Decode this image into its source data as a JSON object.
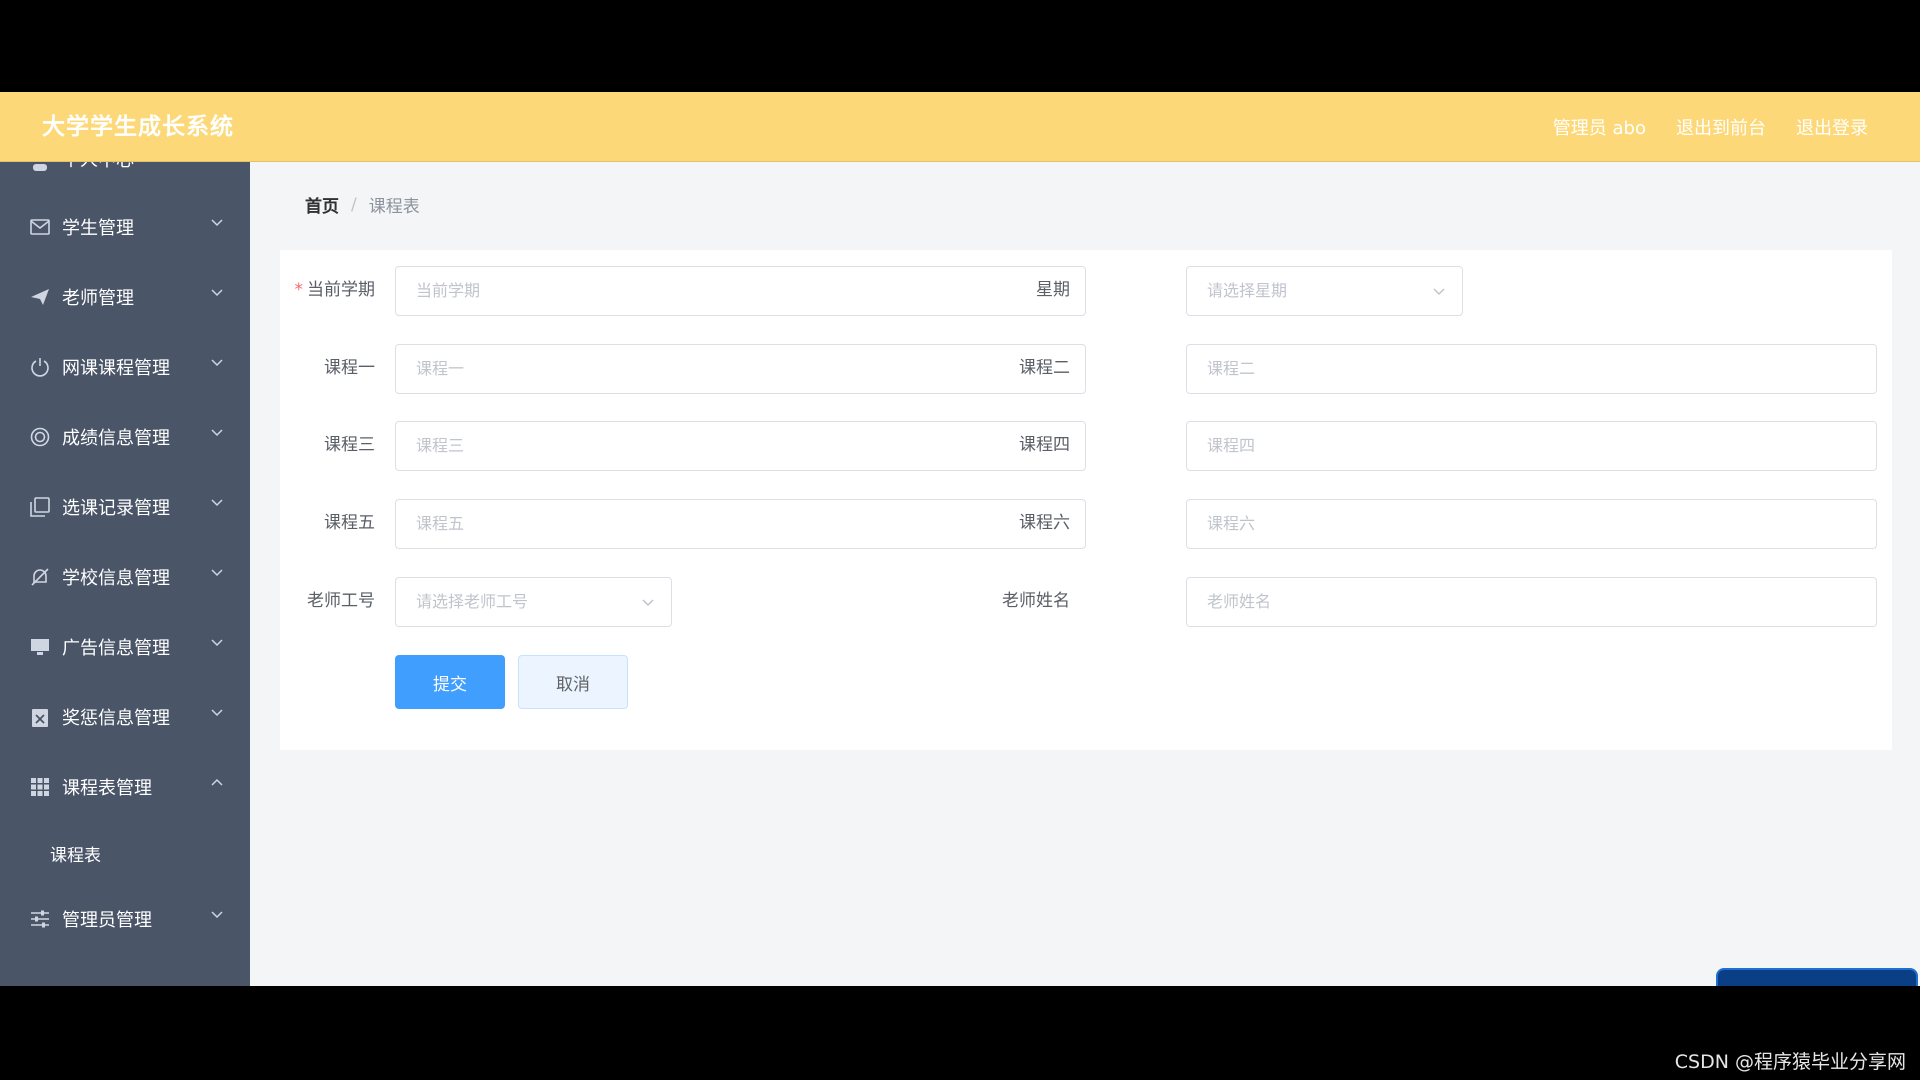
{
  "app": {
    "title": "大学学生成长系统",
    "admin_label": "管理员 abo",
    "back_to_front": "退出到前台",
    "logout": "退出登录"
  },
  "sidebar": {
    "partial_top": "个人中心",
    "items": [
      {
        "label": "学生管理",
        "icon": "mail-icon"
      },
      {
        "label": "老师管理",
        "icon": "send-icon"
      },
      {
        "label": "网课课程管理",
        "icon": "power-icon"
      },
      {
        "label": "成绩信息管理",
        "icon": "target-icon"
      },
      {
        "label": "选课记录管理",
        "icon": "copy-icon"
      },
      {
        "label": "学校信息管理",
        "icon": "bell-off-icon"
      },
      {
        "label": "广告信息管理",
        "icon": "monitor-icon"
      },
      {
        "label": "奖惩信息管理",
        "icon": "clipboard-x-icon"
      },
      {
        "label": "课程表管理",
        "icon": "grid-icon",
        "expanded": true,
        "children": [
          "课程表"
        ]
      },
      {
        "label": "管理员管理",
        "icon": "sliders-icon"
      }
    ]
  },
  "breadcrumb": {
    "home": "首页",
    "separator": "/",
    "current": "课程表"
  },
  "form": {
    "semester": {
      "label": "当前学期",
      "placeholder": "当前学期",
      "required": "*"
    },
    "weekday": {
      "label": "星期",
      "placeholder": "请选择星期"
    },
    "course1": {
      "label": "课程一",
      "placeholder": "课程一"
    },
    "course2": {
      "label": "课程二",
      "placeholder": "课程二"
    },
    "course3": {
      "label": "课程三",
      "placeholder": "课程三"
    },
    "course4": {
      "label": "课程四",
      "placeholder": "课程四"
    },
    "course5": {
      "label": "课程五",
      "placeholder": "课程五"
    },
    "course6": {
      "label": "课程六",
      "placeholder": "课程六"
    },
    "teacher_id": {
      "label": "老师工号",
      "placeholder": "请选择老师工号"
    },
    "teacher_name": {
      "label": "老师姓名",
      "placeholder": "老师姓名"
    },
    "submit": "提交",
    "cancel": "取消"
  },
  "watermark": "CSDN @程序猿毕业分享网",
  "colors": {
    "topbar": "#fcd878",
    "sidebar": "#4a5568",
    "primary": "#409eff"
  }
}
